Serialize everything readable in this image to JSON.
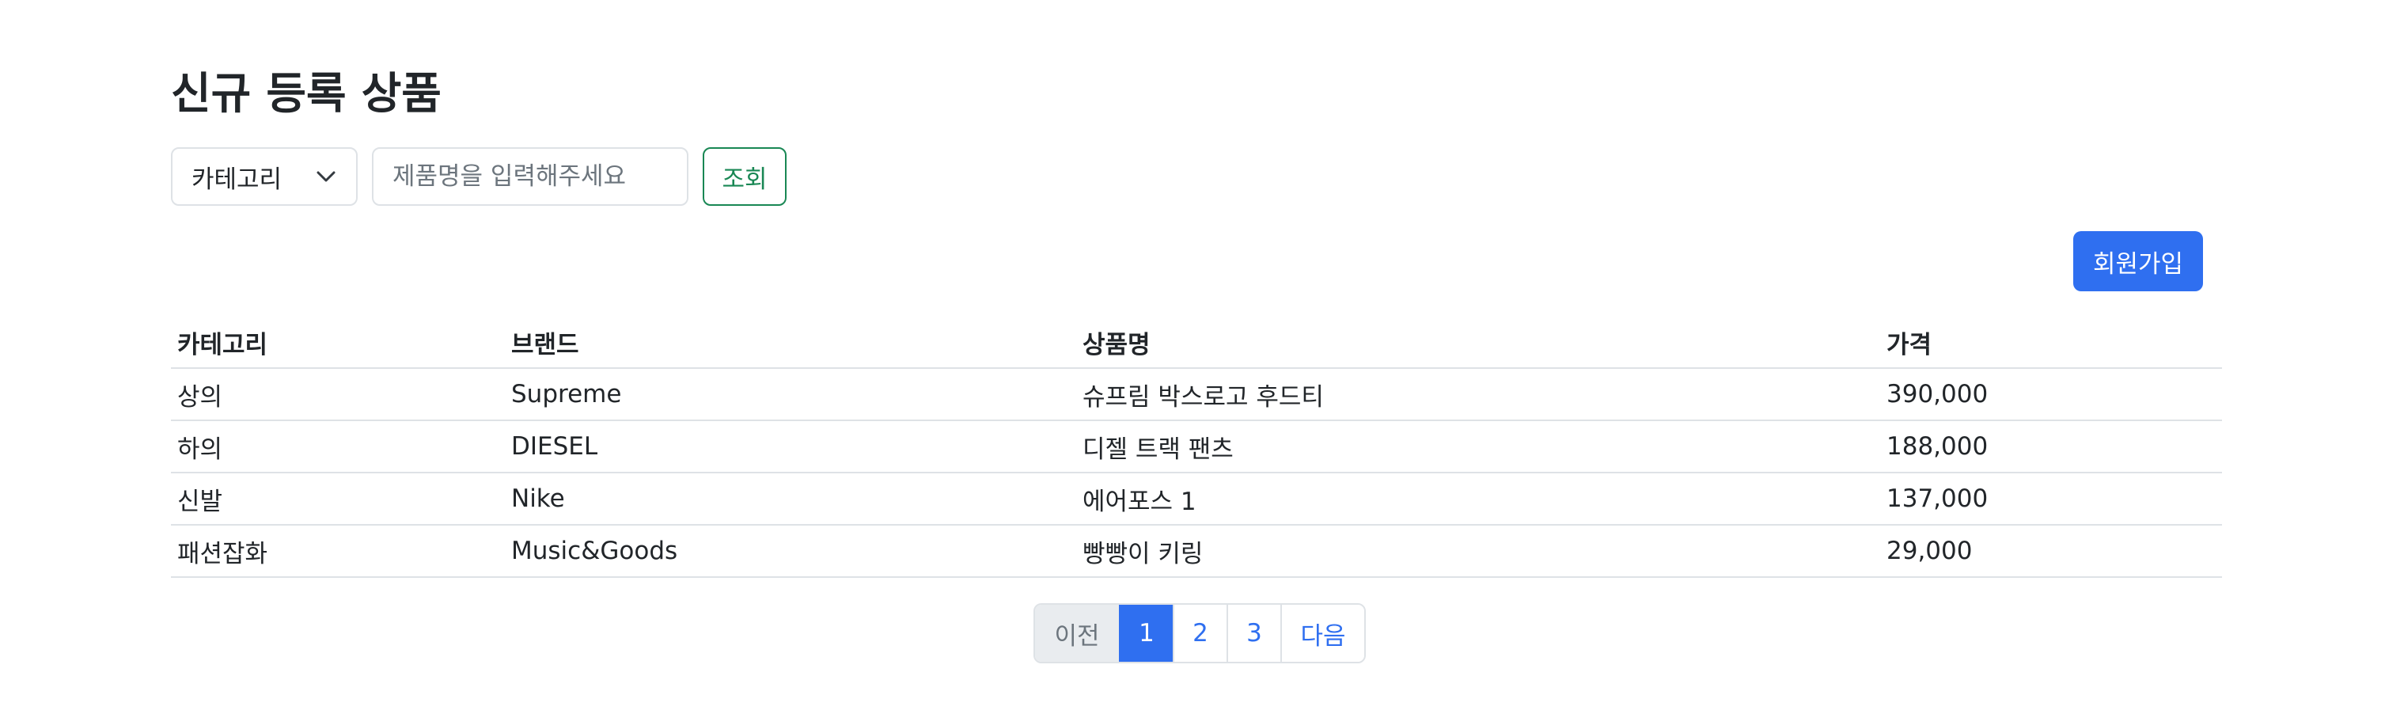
{
  "page_title": "신규 등록 상품",
  "search": {
    "category_selected": "카테고리",
    "input_value": "",
    "input_placeholder": "제품명을 입력해주세요",
    "search_button": "조회"
  },
  "signup_button": "회원가입",
  "table": {
    "headers": [
      "카테고리",
      "브랜드",
      "상품명",
      "가격"
    ],
    "rows": [
      [
        "상의",
        "Supreme",
        "슈프림 박스로고 후드티",
        "390,000"
      ],
      [
        "하의",
        "DIESEL",
        "디젤 트랙 팬츠",
        "188,000"
      ],
      [
        "신발",
        "Nike",
        "에어포스 1",
        "137,000"
      ],
      [
        "패션잡화",
        "Music&Goods",
        "빵빵이 키링",
        "29,000"
      ]
    ]
  },
  "pagination": {
    "prev": "이전",
    "pages": [
      "1",
      "2",
      "3"
    ],
    "active_page": "1",
    "next": "다음"
  },
  "icons": {
    "select_arrow": "chevron-down-icon"
  },
  "colors": {
    "primary": "#2f6ff0",
    "success": "#198754",
    "border": "#dee2e6",
    "text": "#212529",
    "muted": "#6c757d"
  }
}
